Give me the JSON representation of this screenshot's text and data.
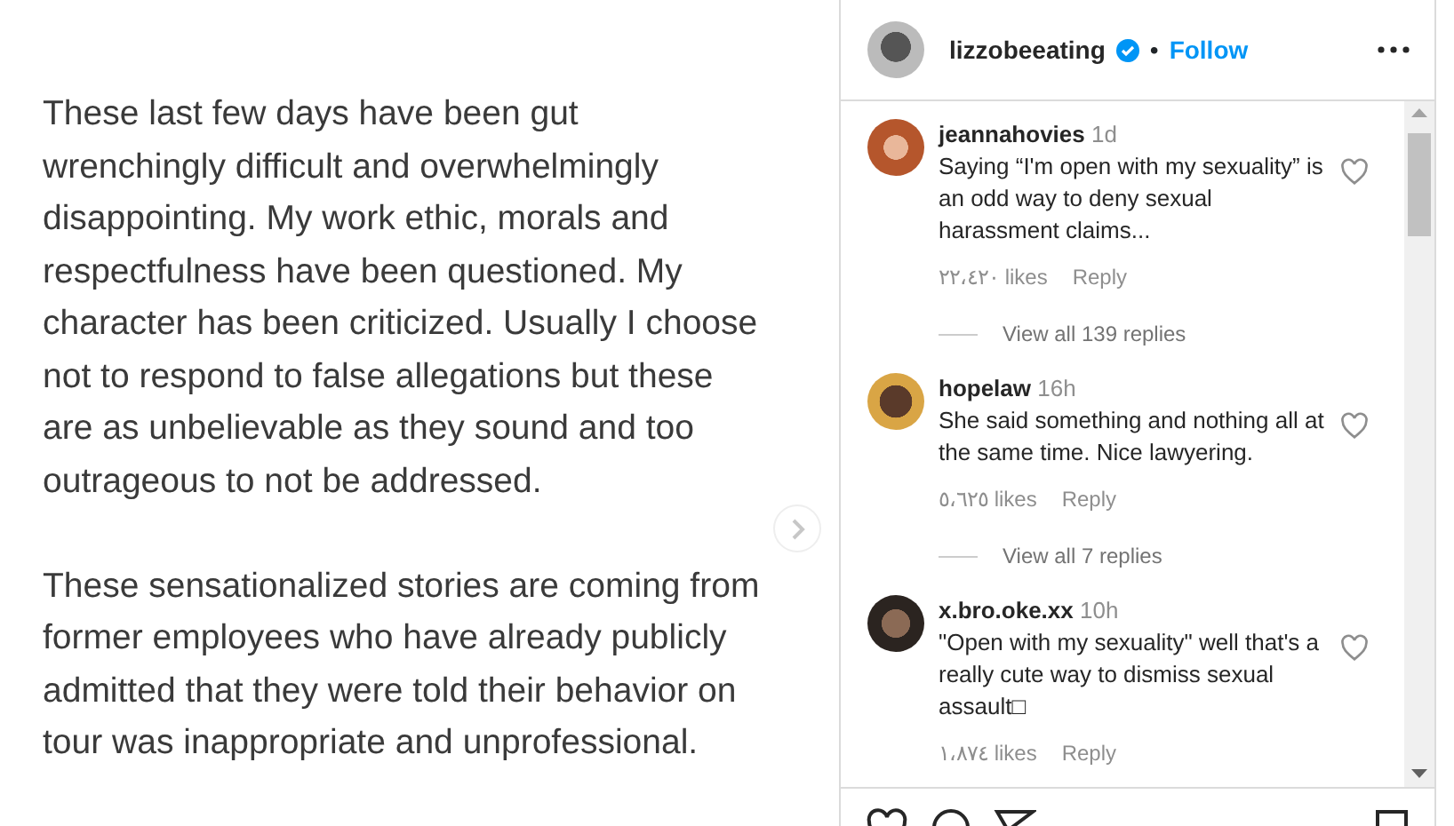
{
  "post_text": [
    "These last few days have been gut wrenchingly difficult and overwhelmingly disappointing. My work ethic, morals and respectfulness have been questioned. My character has been criticized. Usually I choose not to respond to false allegations but these are as unbelievable as they sound and too outrageous to not be addressed.",
    "These sensationalized stories are coming from former employees who have already publicly admitted that they were told their behavior on tour was inappropriate and unprofessional."
  ],
  "header": {
    "username": "lizzobeeating",
    "verified": true,
    "separator": "•",
    "follow": "Follow"
  },
  "comments": [
    {
      "username": "jeannahovies",
      "time": "1d",
      "text": "Saying “I'm open with my sexuality” is an odd way to deny sexual harassment claims...",
      "likes": "٢٢،٤٢٠ likes",
      "reply": "Reply",
      "liked": false,
      "view_replies": "View all 139 replies"
    },
    {
      "username": "hopelaw",
      "time": "16h",
      "text": "She said something and nothing all at the same time. Nice lawyering.",
      "likes": "٥،٦٢٥ likes",
      "reply": "Reply",
      "liked": false,
      "view_replies": "View all 7 replies"
    },
    {
      "username": "x.bro.oke.xx",
      "time": "10h",
      "text": "\"Open with my sexuality\" well that's a really cute way to dismiss sexual assault□",
      "likes": "١،٨٧٤ likes",
      "reply": "Reply",
      "liked": false
    }
  ]
}
